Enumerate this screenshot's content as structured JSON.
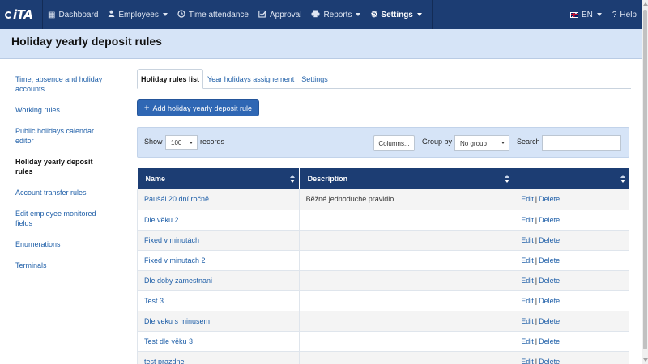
{
  "nav": {
    "logo": "iTA",
    "items": [
      {
        "label": "Dashboard",
        "icon": "grid-icon",
        "dropdown": false
      },
      {
        "label": "Employees",
        "icon": "user-icon",
        "dropdown": true
      },
      {
        "label": "Time attendance",
        "icon": "clock-icon",
        "dropdown": false
      },
      {
        "label": "Approval",
        "icon": "checkbox-icon",
        "dropdown": false
      },
      {
        "label": "Reports",
        "icon": "printer-icon",
        "dropdown": true
      },
      {
        "label": "Settings",
        "icon": "gear-icon",
        "dropdown": true,
        "active": true
      }
    ],
    "language": "EN",
    "help": "Help"
  },
  "page": {
    "title": "Holiday yearly deposit rules"
  },
  "sidebar": {
    "items": [
      {
        "label": "Time, absence and holiday accounts"
      },
      {
        "label": "Working rules"
      },
      {
        "label": "Public holidays calendar editor"
      },
      {
        "label": "Holiday yearly deposit rules",
        "active": true
      },
      {
        "label": "Account transfer rules"
      },
      {
        "label": "Edit employee monitored fields"
      },
      {
        "label": "Enumerations"
      },
      {
        "label": "Terminals"
      }
    ]
  },
  "tabs": [
    {
      "label": "Holiday rules list",
      "active": true
    },
    {
      "label": "Year holidays assignement"
    },
    {
      "label": "Settings"
    }
  ],
  "actions": {
    "add_label": "Add holiday yearly deposit rule"
  },
  "toolbar": {
    "show_label": "Show",
    "records_value": "100",
    "records_label": "records",
    "columns_label": "Columns...",
    "group_label": "Group by",
    "group_value": "No group",
    "search_label": "Search",
    "search_value": ""
  },
  "table": {
    "columns": [
      "Name",
      "Description",
      ""
    ],
    "edit_label": "Edit",
    "delete_label": "Delete",
    "rows": [
      {
        "name": "Paušál 20 dní ročně",
        "description": "Běžné jednoduché pravidlo"
      },
      {
        "name": "Dle věku 2",
        "description": ""
      },
      {
        "name": "Fixed v minutách",
        "description": ""
      },
      {
        "name": "Fixed v minutach 2",
        "description": ""
      },
      {
        "name": "Dle doby zamestnani",
        "description": ""
      },
      {
        "name": "Test 3",
        "description": ""
      },
      {
        "name": "Dle veku s minusem",
        "description": ""
      },
      {
        "name": "Test dle věku 3",
        "description": ""
      },
      {
        "name": "test prazdne",
        "description": ""
      }
    ]
  },
  "colors": {
    "nav_bg": "#1c3d73",
    "header_bg": "#d6e4f7",
    "link": "#1f5fa8",
    "button_bg": "#2f67b4"
  }
}
